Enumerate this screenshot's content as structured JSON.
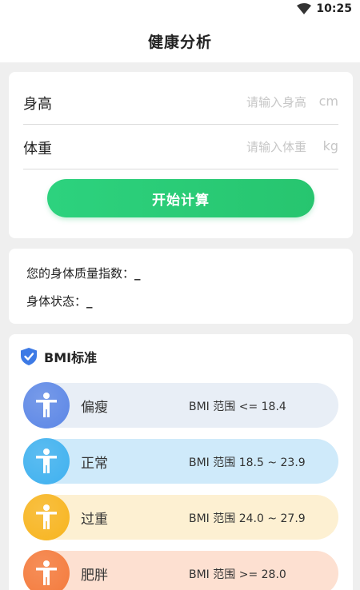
{
  "status": {
    "time": "10:25",
    "wifi_icon": "wifi-icon"
  },
  "header": {
    "title": "健康分析"
  },
  "form": {
    "height_label": "身高",
    "height_placeholder": "请输入身高",
    "height_unit": "cm",
    "weight_label": "体重",
    "weight_placeholder": "请输入体重",
    "weight_unit": "kg",
    "calc_button": "开始计算"
  },
  "result": {
    "bmi_label": "您的身体质量指数：",
    "bmi_value": "_",
    "status_label": "身体状态：",
    "status_value": "_"
  },
  "bmi_standard": {
    "title": "BMI标准",
    "icon": "shield-check-icon",
    "items": [
      {
        "name": "偏瘦",
        "range": "BMI 范围 <= 18.4",
        "bg": "#e8eef6",
        "icon_color": "#5b86e6"
      },
      {
        "name": "正常",
        "range": "BMI 范围 18.5 ~ 23.9",
        "bg": "#cfeafa",
        "icon_color": "#3fb1ef"
      },
      {
        "name": "过重",
        "range": "BMI 范围 24.0 ~ 27.9",
        "bg": "#fdf0d2",
        "icon_color": "#f7b41e"
      },
      {
        "name": "肥胖",
        "range": "BMI 范围 >= 28.0",
        "bg": "#fde0d1",
        "icon_color": "#f47a3b"
      }
    ]
  }
}
